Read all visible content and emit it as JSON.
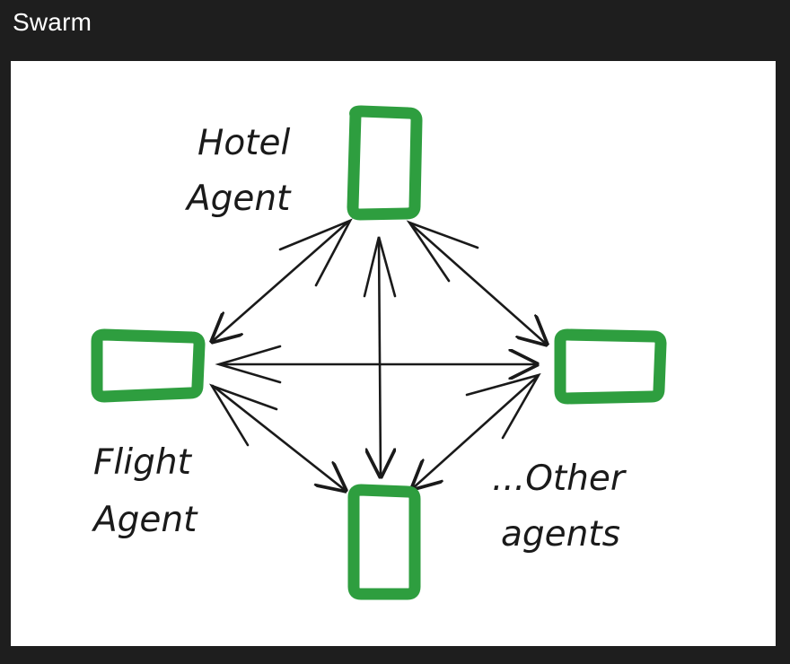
{
  "window": {
    "title": "Swarm"
  },
  "diagram": {
    "node_color": "#2e9e3f",
    "arrow_color": "#1a1a1a",
    "labels": {
      "hotel_line1": "Hotel",
      "hotel_line2": "Agent",
      "flight_line1": "Flight",
      "flight_line2": "Agent",
      "other_line1": "...Other",
      "other_line2": "agents"
    }
  }
}
